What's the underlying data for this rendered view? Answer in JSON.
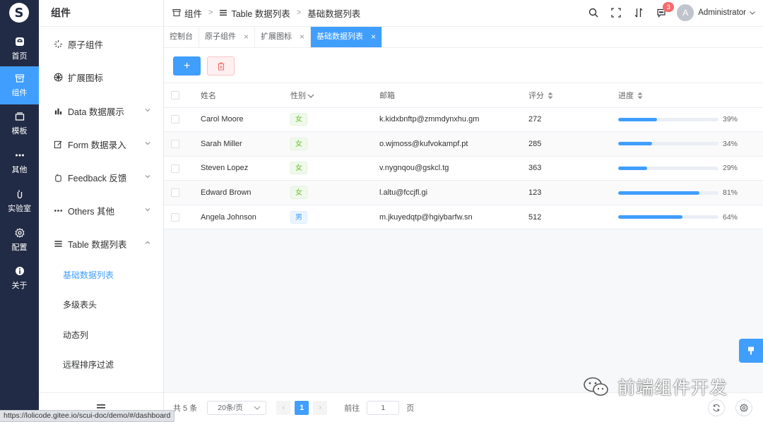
{
  "rail": {
    "logo": "S",
    "items": [
      {
        "label": "首页",
        "icon": "home-icon"
      },
      {
        "label": "组件",
        "icon": "component-icon",
        "active": true
      },
      {
        "label": "模板",
        "icon": "template-icon"
      },
      {
        "label": "其他",
        "icon": "more-icon"
      },
      {
        "label": "实验室",
        "icon": "lab-icon"
      },
      {
        "label": "配置",
        "icon": "gear-icon"
      },
      {
        "label": "关于",
        "icon": "info-icon"
      }
    ]
  },
  "menu": {
    "title": "组件",
    "items": [
      {
        "label": "原子组件",
        "icon": "sparkle-icon"
      },
      {
        "label": "扩展图标",
        "icon": "grid-wheel-icon"
      },
      {
        "label": "Data 数据展示",
        "icon": "bar-chart-icon"
      },
      {
        "label": "Form 数据录入",
        "icon": "edit-icon"
      },
      {
        "label": "Feedback 反馈",
        "icon": "hand-icon"
      },
      {
        "label": "Others 其他",
        "icon": "more-icon"
      },
      {
        "label": "Table 数据列表",
        "icon": "list-icon"
      }
    ],
    "sub_items": [
      "基础数据列表",
      "多级表头",
      "动态列",
      "远程排序过滤"
    ],
    "active_sub": "基础数据列表"
  },
  "header": {
    "breadcrumbs": [
      "组件",
      "Table 数据列表",
      "基础数据列表"
    ],
    "notification_count": "3",
    "avatar_letter": "A",
    "user_name": "Administrator"
  },
  "tabs": [
    {
      "label": "控制台",
      "closable": false
    },
    {
      "label": "原子组件",
      "closable": true
    },
    {
      "label": "扩展图标",
      "closable": true
    },
    {
      "label": "基础数据列表",
      "closable": true,
      "active": true
    }
  ],
  "toolbar": {
    "add_label": "+"
  },
  "table": {
    "columns": [
      "姓名",
      "性别",
      "邮箱",
      "评分",
      "进度"
    ],
    "rows": [
      {
        "name": "Carol Moore",
        "gender": "女",
        "email": "k.kidxbnftp@zmmdynxhu.gm",
        "score": "272",
        "progress": 39,
        "progress_text": "39%"
      },
      {
        "name": "Sarah Miller",
        "gender": "女",
        "email": "o.wjmoss@kufvokampf.pt",
        "score": "285",
        "progress": 34,
        "progress_text": "34%"
      },
      {
        "name": "Steven Lopez",
        "gender": "女",
        "email": "v.nygnqou@gskcl.tg",
        "score": "363",
        "progress": 29,
        "progress_text": "29%"
      },
      {
        "name": "Edward Brown",
        "gender": "女",
        "email": "l.altu@fccjfl.gi",
        "score": "123",
        "progress": 81,
        "progress_text": "81%"
      },
      {
        "name": "Angela Johnson",
        "gender": "男",
        "email": "m.jkuyedqtp@hgiybarfw.sn",
        "score": "512",
        "progress": 64,
        "progress_text": "64%"
      }
    ]
  },
  "pager": {
    "total": "共 5 条",
    "page_size": "20条/页",
    "current_page": "1",
    "goto_label": "前往",
    "goto_value": "1",
    "goto_unit": "页"
  },
  "watermark": "前端组件开发",
  "status_url": "https://lolicode.gitee.io/scui-doc/demo/#/dashboard",
  "colors": {
    "primary": "#409eff",
    "rail": "#222b45",
    "danger": "#f56c6c"
  }
}
